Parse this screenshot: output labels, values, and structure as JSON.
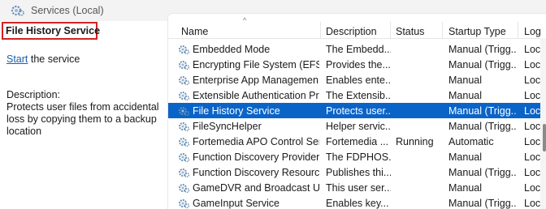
{
  "window": {
    "title": "Services (Local)",
    "icon": "gears-icon"
  },
  "details": {
    "service_name": "File History Service",
    "start_link": "Start",
    "start_suffix": " the service",
    "description_label": "Description:",
    "description_text": "Protects user files from accidental loss by copying them to a backup location"
  },
  "table": {
    "columns": [
      "Name",
      "Description",
      "Status",
      "Startup Type",
      "Log"
    ],
    "sort_indicator": "^",
    "selected_row": 4,
    "rows": [
      {
        "name": "Embedded Mode",
        "description": "The Embedd...",
        "status": "",
        "startup": "Manual (Trigg...",
        "log": "Loc"
      },
      {
        "name": "Encrypting File System (EFS)",
        "description": "Provides the...",
        "status": "",
        "startup": "Manual (Trigg...",
        "log": "Loc"
      },
      {
        "name": "Enterprise App Managemen...",
        "description": "Enables ente...",
        "status": "",
        "startup": "Manual",
        "log": "Loc"
      },
      {
        "name": "Extensible Authentication Pr...",
        "description": "The Extensib...",
        "status": "",
        "startup": "Manual",
        "log": "Loc"
      },
      {
        "name": "File History Service",
        "description": "Protects user...",
        "status": "",
        "startup": "Manual (Trigg...",
        "log": "Loc"
      },
      {
        "name": "FileSyncHelper",
        "description": "Helper servic...",
        "status": "",
        "startup": "Manual (Trigg...",
        "log": "Loc"
      },
      {
        "name": "Fortemedia APO Control Ser...",
        "description": "Fortemedia ...",
        "status": "Running",
        "startup": "Automatic",
        "log": "Loc"
      },
      {
        "name": "Function Discovery Provider ...",
        "description": "The FDPHOS...",
        "status": "",
        "startup": "Manual",
        "log": "Loc"
      },
      {
        "name": "Function Discovery Resourc...",
        "description": "Publishes thi...",
        "status": "",
        "startup": "Manual (Trigg...",
        "log": "Loc"
      },
      {
        "name": "GameDVR and Broadcast Us...",
        "description": "This user ser...",
        "status": "",
        "startup": "Manual",
        "log": "Loc"
      },
      {
        "name": "GameInput Service",
        "description": "Enables key...",
        "status": "",
        "startup": "Manual (Trigg...",
        "log": "Loc"
      }
    ]
  },
  "colors": {
    "selection": "#0a64c8",
    "highlight_box": "#d32222",
    "link": "#1a5fb4"
  }
}
